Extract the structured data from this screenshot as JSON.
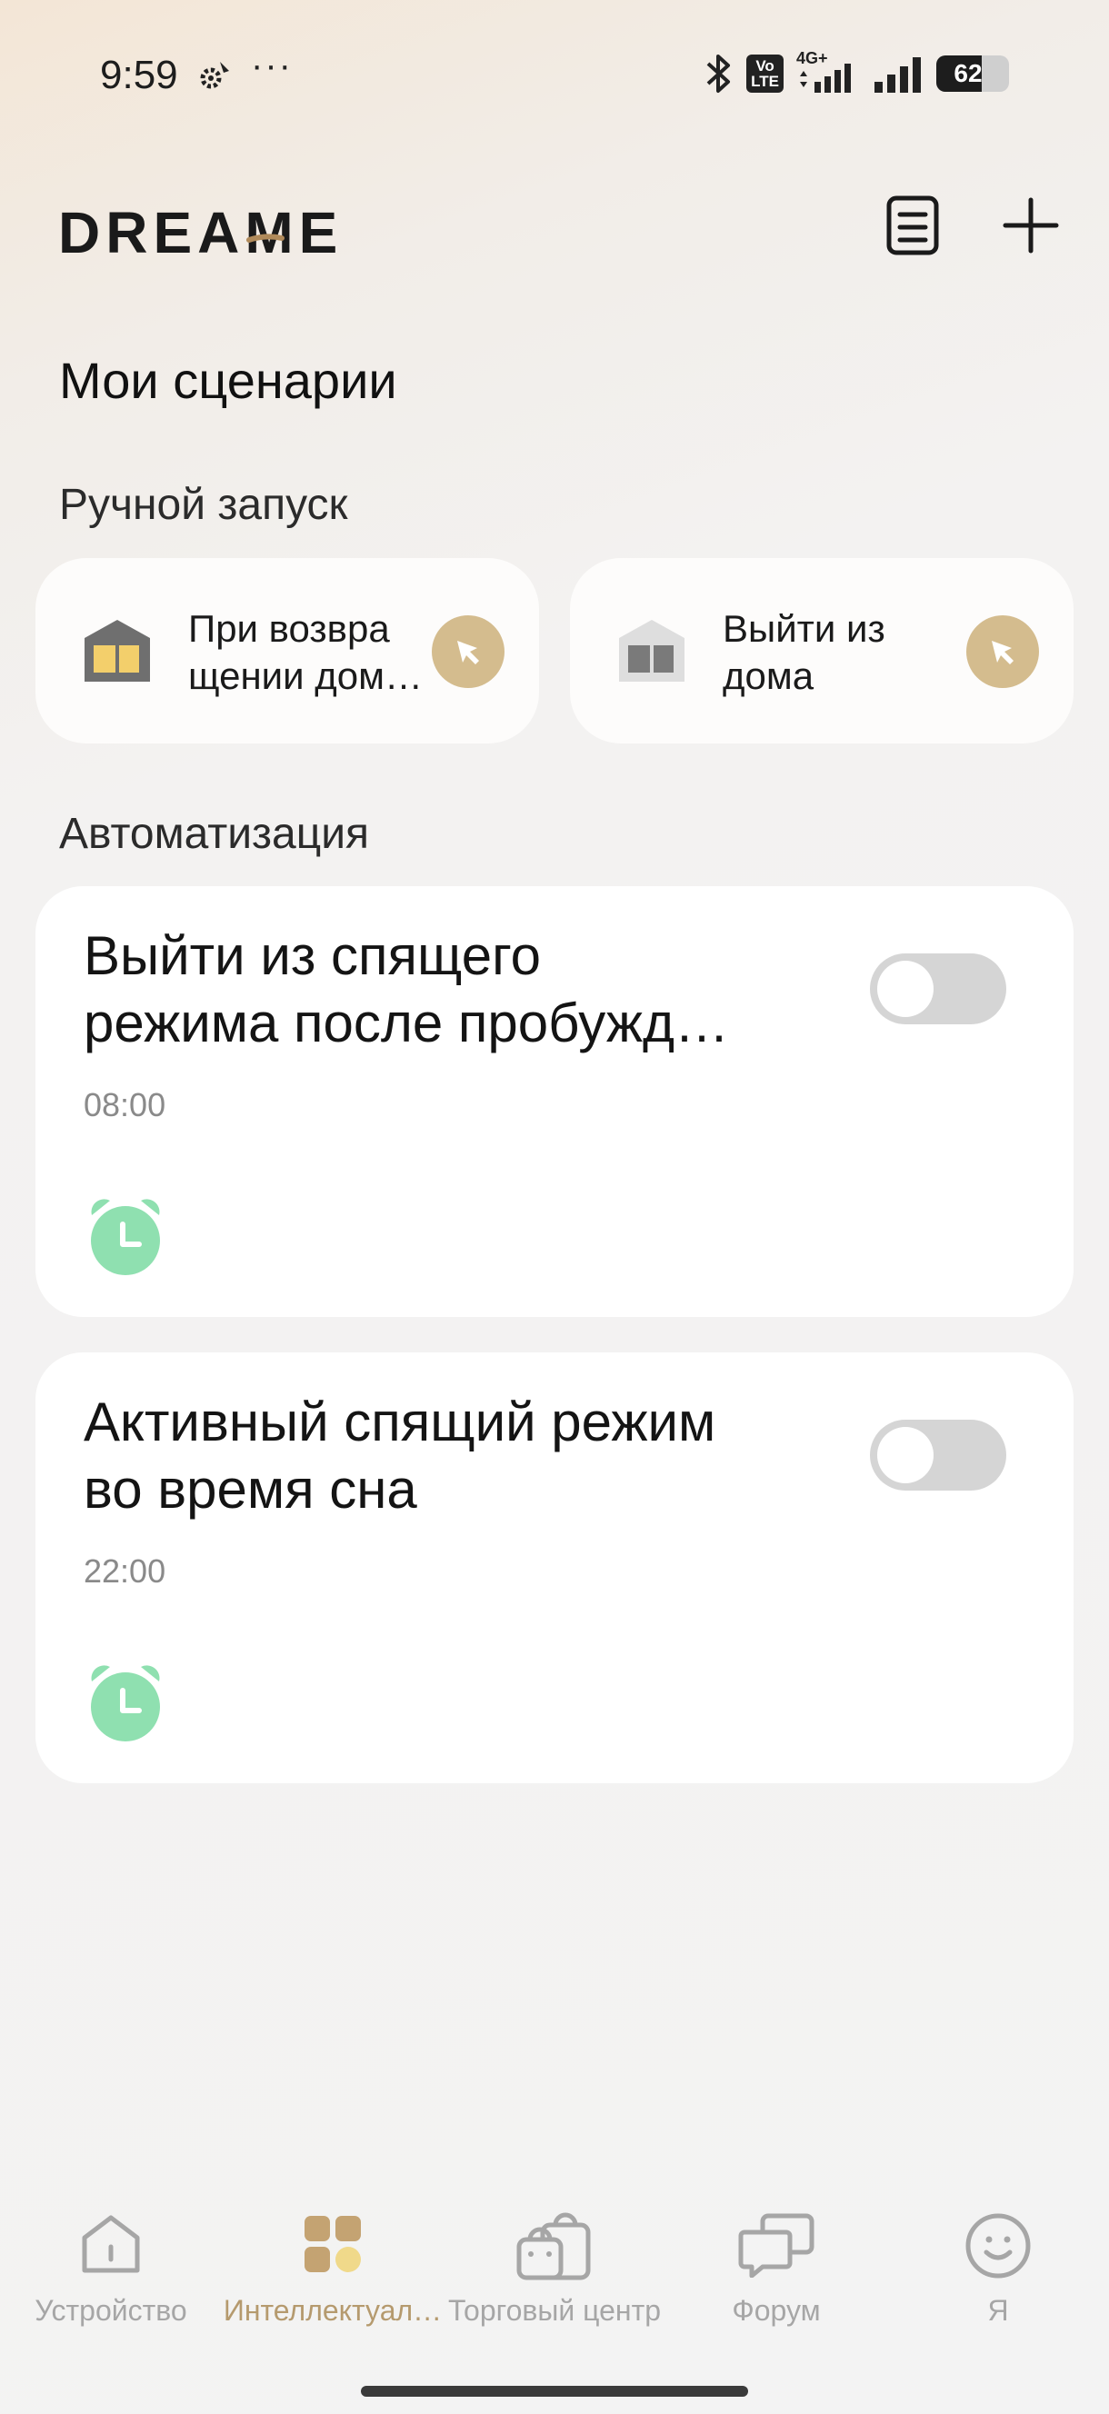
{
  "status_bar": {
    "time": "9:59",
    "dots": "···",
    "volte_top": "Vo",
    "volte_bottom": "LTE",
    "network": "4G+",
    "battery": "62",
    "battery_level": 0.62
  },
  "header": {
    "logo_text": "DREAME",
    "accent_color": "#b08a5a"
  },
  "page": {
    "title": "Мои сценарии",
    "manual_section": "Ручной запуск",
    "automation_section": "Автоматизация"
  },
  "manual_scenarios": [
    {
      "line1": "При возвра",
      "line2": "щении дом…",
      "icon": "home-return-icon"
    },
    {
      "line1": "Выйти из",
      "line2": "дома",
      "icon": "home-leave-icon"
    }
  ],
  "automations": [
    {
      "line1": "Выйти из спящего",
      "line2": "режима после пробужд…",
      "time": "08:00",
      "enabled": false,
      "icon": "alarm-clock-icon"
    },
    {
      "line1": "Активный спящий режим",
      "line2": "во время сна",
      "time": "22:00",
      "enabled": false,
      "icon": "alarm-clock-icon"
    }
  ],
  "nav": {
    "device": "Устройство",
    "smart": "Интеллектуал…",
    "shop": "Торговый центр",
    "forum": "Форум",
    "me": "Я"
  },
  "colors": {
    "gold": "#d4bc8e",
    "alarm_green": "#8fe0b0",
    "nav_active": "#b59a6e"
  }
}
